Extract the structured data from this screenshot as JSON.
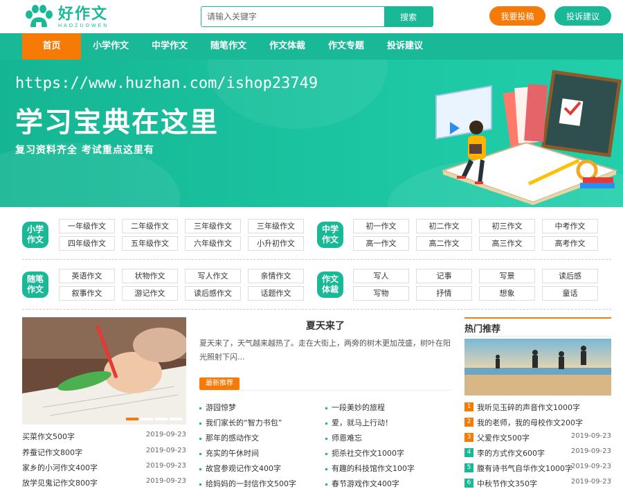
{
  "header": {
    "logo_cn": "好作文",
    "logo_en": "HAOZUOWEN",
    "search_placeholder": "请输入关键字",
    "search_button": "搜索",
    "submit_button": "我要投稿",
    "complain_button": "投诉建议"
  },
  "nav": [
    "首页",
    "小学作文",
    "中学作文",
    "随笔作文",
    "作文体裁",
    "作文专题",
    "投诉建议"
  ],
  "banner": {
    "watermark": "https://www.huzhan.com/ishop23749",
    "title": "学习宝典在这里",
    "subtitle": "复习资料齐全 考试重点这里有"
  },
  "categories": [
    {
      "badge": [
        "小学",
        "作文"
      ],
      "tags": [
        "一年级作文",
        "二年级作文",
        "三年级作文",
        "三年级作文",
        "四年级作文",
        "五年级作文",
        "六年级作文",
        "小升初作文"
      ]
    },
    {
      "badge": [
        "中学",
        "作文"
      ],
      "tags": [
        "初一作文",
        "初二作文",
        "初三作文",
        "中考作文",
        "高一作文",
        "高二作文",
        "高三作文",
        "高考作文"
      ]
    },
    {
      "badge": [
        "随笔",
        "作文"
      ],
      "tags": [
        "英语作文",
        "状物作文",
        "写人作文",
        "亲情作文",
        "叙事作文",
        "游记作文",
        "读后感作文",
        "话题作文"
      ]
    },
    {
      "badge": [
        "作文",
        "体裁"
      ],
      "tags": [
        "写人",
        "记事",
        "写景",
        "读后感",
        "写物",
        "抒情",
        "想象",
        "童话"
      ]
    }
  ],
  "left_list": [
    {
      "title": "买菜作文500字",
      "date": "2019-09-23"
    },
    {
      "title": "养蚕记作文800字",
      "date": "2019-09-23"
    },
    {
      "title": "家乡的小河作文400字",
      "date": "2019-09-23"
    },
    {
      "title": "放学见鬼记作文800字",
      "date": "2019-09-23"
    }
  ],
  "feature": {
    "title": "夏天来了",
    "desc": "夏天来了，天气越来越热了。走在大街上，两旁的树木更加茂盛，树叶在阳光照射下闪...",
    "latest_tag": "最新推荐"
  },
  "latest_left": [
    "游园惊梦",
    "我们家长的“智力书包”",
    "那年的感动作文",
    "充实的午休时间",
    "故宫参观记作文400字",
    "给妈妈的一封信作文500字"
  ],
  "latest_right": [
    "一段美妙的旅程",
    "爱，就马上行动！",
    "师恩难忘",
    "扼杀社交作文1000字",
    "有趣的科技馆作文100字",
    "春节游戏作文400字"
  ],
  "hot": {
    "title": "热门推荐",
    "items": [
      {
        "n": "1",
        "title": "我听见玉碎的声音作文1000字",
        "date": ""
      },
      {
        "n": "2",
        "title": "我的老师，我的母校作文200字",
        "date": ""
      },
      {
        "n": "3",
        "title": "父爱作文500字",
        "date": "2019-09-23"
      },
      {
        "n": "4",
        "title": "李的方式作文600字",
        "date": "2019-09-23"
      },
      {
        "n": "5",
        "title": "腹有诗书气自华作文1000字",
        "date": "2019-09-23"
      },
      {
        "n": "6",
        "title": "中秋节作文350字",
        "date": "2019-09-23"
      }
    ]
  },
  "colors": {
    "brand": "#19b897",
    "accent": "#f57a06"
  }
}
